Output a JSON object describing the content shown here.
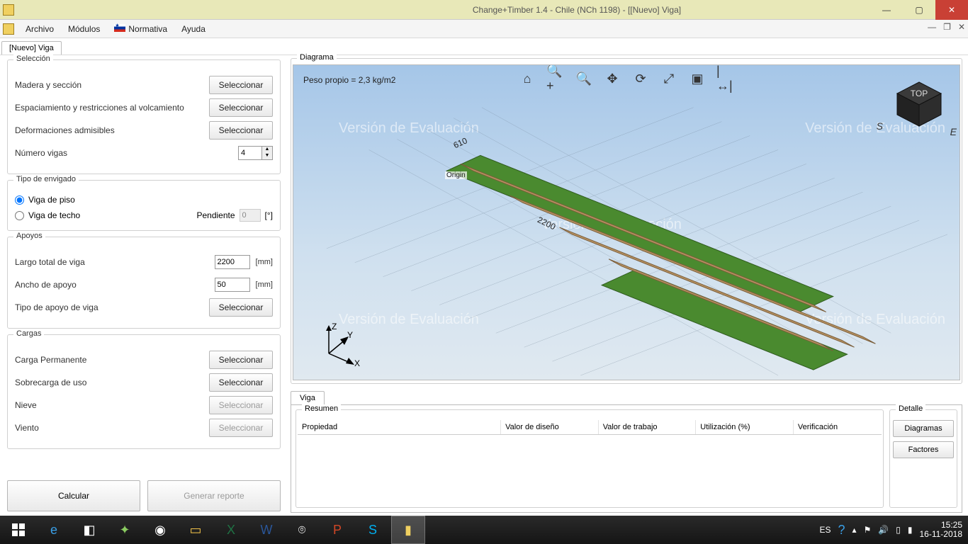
{
  "titlebar": {
    "title": "Change+Timber 1.4 - Chile (NCh 1198) - [[Nuevo] Viga]"
  },
  "menu": {
    "archivo": "Archivo",
    "modulos": "Módulos",
    "normativa": "Normativa",
    "ayuda": "Ayuda"
  },
  "doctab": "[Nuevo] Viga",
  "left": {
    "seleccion": {
      "legend": "Selección",
      "madera": "Madera y sección",
      "espac": "Espaciamiento y restricciones al volcamiento",
      "deform": "Deformaciones admisibles",
      "numvigas_lbl": "Número vigas",
      "numvigas": "4",
      "sel_btn": "Seleccionar"
    },
    "envigado": {
      "legend": "Tipo de envigado",
      "piso": "Viga de piso",
      "techo": "Viga de techo",
      "pendiente_lbl": "Pendiente",
      "pendiente": "0",
      "pendiente_unit": "[°]"
    },
    "apoyos": {
      "legend": "Apoyos",
      "largo_lbl": "Largo total de viga",
      "largo": "2200",
      "ancho_lbl": "Ancho de apoyo",
      "ancho": "50",
      "unit": "[mm]",
      "tipo_lbl": "Tipo de apoyo de viga",
      "sel_btn": "Seleccionar"
    },
    "cargas": {
      "legend": "Cargas",
      "perm": "Carga Permanente",
      "sobre": "Sobrecarga de uso",
      "nieve": "Nieve",
      "viento": "Viento",
      "sel_btn": "Seleccionar"
    },
    "calcular": "Calcular",
    "reporte": "Generar reporte"
  },
  "diagram": {
    "legend": "Diagrama",
    "peso": "Peso propio = 2,3 kg/m2",
    "watermark": "Versión de Evaluación",
    "origin": "Origin",
    "dim1": "610",
    "dim2": "2200",
    "compass_s": "S",
    "compass_e": "E",
    "cube_top": "TOP",
    "axes": {
      "x": "X",
      "y": "Y",
      "z": "Z"
    }
  },
  "results": {
    "tab": "Viga",
    "resumen": "Resumen",
    "detalle": "Detalle",
    "cols": {
      "prop": "Propiedad",
      "vdis": "Valor de diseño",
      "vtrab": "Valor de trabajo",
      "util": "Utilización (%)",
      "verif": "Verificación"
    },
    "btn_diag": "Diagramas",
    "btn_fact": "Factores"
  },
  "taskbar": {
    "lang": "ES",
    "time": "15:25",
    "date": "16-11-2018"
  }
}
